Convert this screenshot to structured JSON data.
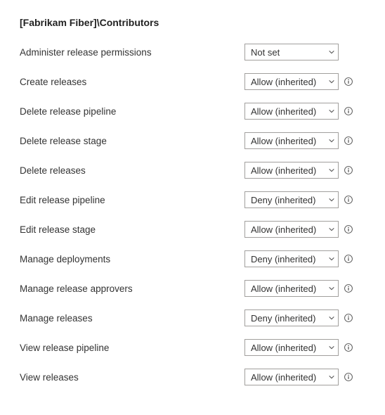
{
  "title": "[Fabrikam Fiber]\\Contributors",
  "permissions": [
    {
      "label": "Administer release permissions",
      "value": "Not set",
      "info": false
    },
    {
      "label": "Create releases",
      "value": "Allow (inherited)",
      "info": true
    },
    {
      "label": "Delete release pipeline",
      "value": "Allow (inherited)",
      "info": true
    },
    {
      "label": "Delete release stage",
      "value": "Allow (inherited)",
      "info": true
    },
    {
      "label": "Delete releases",
      "value": "Allow (inherited)",
      "info": true
    },
    {
      "label": "Edit release pipeline",
      "value": "Deny (inherited)",
      "info": true
    },
    {
      "label": "Edit release stage",
      "value": "Allow (inherited)",
      "info": true
    },
    {
      "label": "Manage deployments",
      "value": "Deny (inherited)",
      "info": true
    },
    {
      "label": "Manage release approvers",
      "value": "Allow (inherited)",
      "info": true
    },
    {
      "label": "Manage releases",
      "value": "Deny (inherited)",
      "info": true
    },
    {
      "label": "View release pipeline",
      "value": "Allow (inherited)",
      "info": true
    },
    {
      "label": "View releases",
      "value": "Allow (inherited)",
      "info": true
    }
  ]
}
